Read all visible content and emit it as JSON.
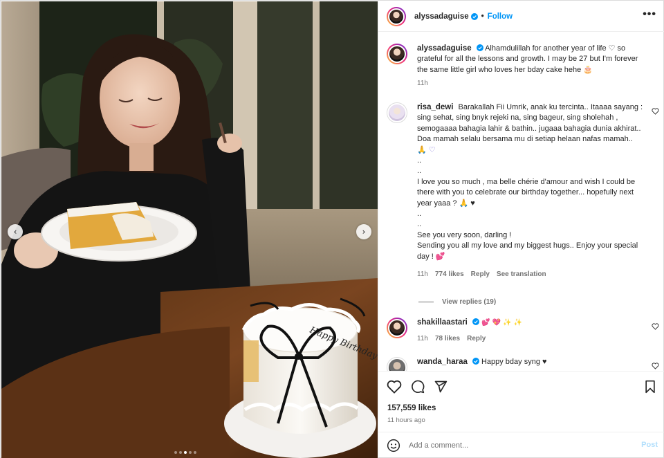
{
  "header": {
    "username": "alyssadaguise",
    "separator": "•",
    "follow_label": "Follow",
    "more_label": "•••"
  },
  "caption": {
    "username": "alyssadaguise",
    "text": "Alhamdulillah for another year of life ♡ so grateful for all the lessons and growth. I may be 27 but I'm forever the same little girl who loves her bday cake hehe 🎂",
    "time": "11h"
  },
  "comments": [
    {
      "username": "risa_dewi",
      "lines": [
        "Barakallah Fii Umrik, anak ku tercinta.. Itaaaa sayang : sing sehat, sing bnyk rejeki na, sing bageur, sing sholehah , semogaaaa bahagia lahir & bathin.. jugaaa bahagia dunia akhirat..",
        "Doa mamah selalu bersama mu di setiap helaan nafas mamah..",
        "🙏 ♡",
        "..",
        "..",
        "I love you so much , ma belle chérie d'amour and wish I could be there with you to celebrate our birthday together... hopefully next year yaaa ? 🙏 ♥",
        "..",
        "..",
        "See you very soon, darling !",
        "Sending you all my love and my biggest hugs.. Enjoy your special day ! 💕"
      ],
      "time": "11h",
      "likes": "774 likes",
      "reply": "Reply",
      "translate": "See translation",
      "view_replies": "View replies (19)"
    },
    {
      "username": "shakillaastari",
      "text": "💕 💖 ✨ ✨",
      "time": "11h",
      "likes": "78 likes",
      "reply": "Reply"
    },
    {
      "username": "wanda_haraa",
      "text": "Happy bday syng ♥"
    }
  ],
  "post": {
    "likes": "157,559 likes",
    "time": "11 hours ago"
  },
  "composer": {
    "placeholder": "Add a comment...",
    "post_label": "Post"
  },
  "photo": {
    "cake_text": "Happy Birthday Alyssa",
    "carousel_count": 5,
    "carousel_active": 3,
    "prev_label": "‹",
    "next_label": "›"
  },
  "colors": {
    "link": "#0095f6",
    "verified": "#0095f6",
    "heart": "#ed4956",
    "muted": "#737373"
  }
}
